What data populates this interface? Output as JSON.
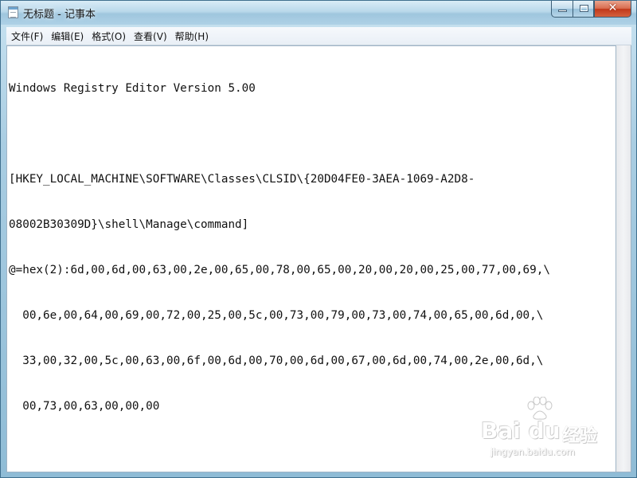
{
  "window": {
    "title": "无标题 - 记事本"
  },
  "menu": {
    "items": [
      {
        "label": "文件(F)"
      },
      {
        "label": "编辑(E)"
      },
      {
        "label": "格式(O)"
      },
      {
        "label": "查看(V)"
      },
      {
        "label": "帮助(H)"
      }
    ]
  },
  "editor": {
    "lines": [
      "Windows Registry Editor Version 5.00",
      "",
      "[HKEY_LOCAL_MACHINE\\SOFTWARE\\Classes\\CLSID\\{20D04FE0-3AEA-1069-A2D8-",
      "08002B30309D}\\shell\\Manage\\command]",
      "@=hex(2):6d,00,6d,00,63,00,2e,00,65,00,78,00,65,00,20,00,20,00,25,00,77,00,69,\\",
      "  00,6e,00,64,00,69,00,72,00,25,00,5c,00,73,00,79,00,73,00,74,00,65,00,6d,00,\\",
      "  33,00,32,00,5c,00,63,00,6f,00,6d,00,70,00,6d,00,67,00,6d,00,74,00,2e,00,6d,\\",
      "  00,73,00,63,00,00,00"
    ]
  },
  "watermark": {
    "brand": "Bai du",
    "suffix": "经验",
    "url": "jingyan.baidu.com"
  },
  "icons": {
    "app": "notepad-icon",
    "minimize": "minimize-icon",
    "maximize": "maximize-icon",
    "close": "close-icon",
    "watermark": "paw-icon"
  },
  "colors": {
    "close_button": "#c1381a",
    "titlebar": "#b9d8ea"
  }
}
